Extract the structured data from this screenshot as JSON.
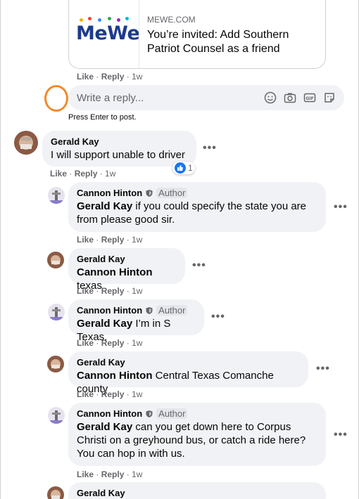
{
  "link_card": {
    "logo_text": "MeWe",
    "domain": "MEWE.COM",
    "title": "You’re invited: Add Southern Patriot Counsel as a friend",
    "logo_colors": [
      "#f4b400",
      "#ea4335",
      "#4285f4",
      "#34a853",
      "#9c27b0",
      "#00bcd4"
    ]
  },
  "post_actions": {
    "like": "Like",
    "reply": "Reply",
    "time": "1w"
  },
  "reply_box": {
    "placeholder": "Write a reply...",
    "hint": "Press Enter to post.",
    "icons": [
      "emoji-icon",
      "camera-icon",
      "gif-icon",
      "sticker-icon"
    ]
  },
  "comments": [
    {
      "author": "Gerald Kay",
      "text": "I will support unable to driver",
      "reaction_count": "1",
      "actions": {
        "like": "Like",
        "reply": "Reply",
        "time": "1w"
      }
    },
    {
      "author": "Cannon Hinton",
      "badge": "Author",
      "mention": "Gerald Kay",
      "text": " if you could specify the state you are from please good sir.",
      "actions": {
        "like": "Like",
        "reply": "Reply",
        "time": "1w"
      }
    },
    {
      "author": "Gerald Kay",
      "mention": "Cannon Hinton",
      "text": " texas",
      "actions": {
        "like": "Like",
        "reply": "Reply",
        "time": "1w"
      }
    },
    {
      "author": "Cannon Hinton",
      "badge": "Author",
      "mention": "Gerald Kay",
      "text": " I’m in S Texas.",
      "actions": {
        "like": "Like",
        "reply": "Reply",
        "time": "1w"
      }
    },
    {
      "author": "Gerald Kay",
      "mention": "Cannon Hinton",
      "text": " Central Texas Comanche county",
      "actions": {
        "like": "Like",
        "reply": "Reply",
        "time": "1w"
      }
    },
    {
      "author": "Cannon Hinton",
      "badge": "Author",
      "mention": "Gerald Kay",
      "text": " can you get down here to Corpus Christi on a greyhound bus, or catch a ride here? You can hop in with us.",
      "actions": {
        "like": "Like",
        "reply": "Reply",
        "time": "1w"
      }
    },
    {
      "author": "Gerald Kay"
    }
  ],
  "more_label": "•••",
  "colors": {
    "accent": "#1877f2",
    "annotation": "#f08a2c",
    "bubble": "#f0f2f5"
  }
}
